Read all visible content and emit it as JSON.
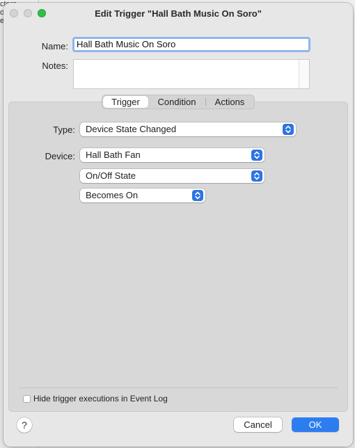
{
  "background": {
    "fragments": [
      "ctors",
      "oc",
      "ec"
    ]
  },
  "dialog": {
    "title": "Edit Trigger \"Hall Bath Music On Soro\"",
    "name_label": "Name:",
    "name_value": "Hall Bath Music On Soro",
    "notes_label": "Notes:",
    "notes_value": ""
  },
  "tabs": [
    {
      "label": "Trigger",
      "selected": true
    },
    {
      "label": "Condition",
      "selected": false
    },
    {
      "label": "Actions",
      "selected": false
    }
  ],
  "trigger": {
    "type_label": "Type:",
    "type_value": "Device State Changed",
    "device_label": "Device:",
    "device_value": "Hall Bath Fan",
    "state_value": "On/Off State",
    "condition_value": "Becomes On"
  },
  "footer": {
    "hide_checkbox_label": "Hide trigger executions in Event Log",
    "hide_checked": false,
    "help_label": "?",
    "cancel_label": "Cancel",
    "ok_label": "OK"
  },
  "colors": {
    "accent": "#2e7df0",
    "zoom_button": "#2fbf46",
    "focus_ring": "#8fb6ec"
  },
  "icons": {
    "popup": "chevron-up-down-icon",
    "help": "help-icon"
  }
}
